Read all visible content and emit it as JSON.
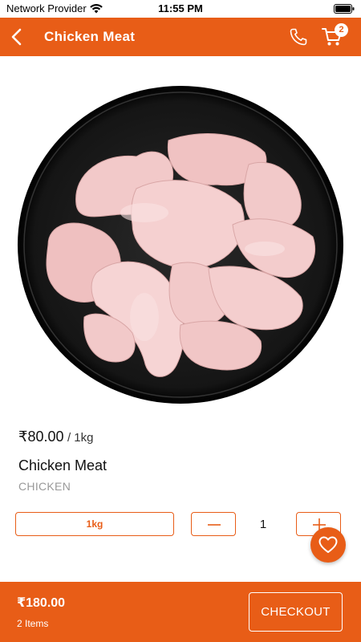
{
  "status_bar": {
    "carrier": "Network Provider",
    "time": "11:55 PM"
  },
  "header": {
    "title": "Chicken Meat",
    "cart_count": "2"
  },
  "product": {
    "price": "₹80.00",
    "unit": "/ 1kg",
    "name": "Chicken Meat",
    "category": "CHICKEN",
    "variant": "1kg",
    "quantity": "1"
  },
  "footer": {
    "total": "₹180.00",
    "items": "2 Items",
    "checkout_label": "CHECKOUT"
  },
  "colors": {
    "accent": "#e85d17"
  }
}
